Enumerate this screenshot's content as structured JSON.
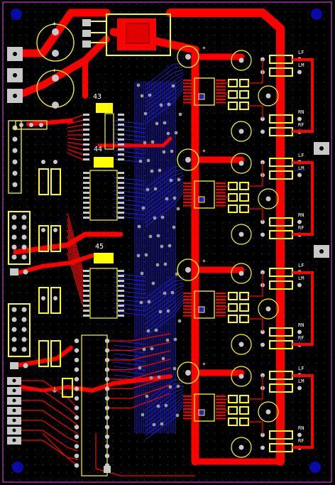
{
  "colors": {
    "background": "#000000",
    "top_copper": "#ff0000",
    "bottom_copper": "#1f1fd6",
    "silkscreen": "#ffff00",
    "pad": "#c8c8c8",
    "via": "#9a9aa0",
    "outline": "#c040c0",
    "mount_hole": "#0a0aa8",
    "label_text": "#ffffff"
  },
  "components": {
    "u43_label": "43",
    "u44_label": "44",
    "u45_label": "45"
  },
  "channel_labels": [
    {
      "top": "LF",
      "mid": "LM",
      "bot1": "RN",
      "bot2": "RF"
    },
    {
      "top": "LF",
      "mid": "LM",
      "bot1": "RN",
      "bot2": "RF"
    },
    {
      "top": "LF",
      "mid": "LM",
      "bot1": "RN",
      "bot2": "RF"
    },
    {
      "top": "LF",
      "mid": "LM",
      "bot1": "RN",
      "bot2": "RF"
    }
  ],
  "marks": {
    "plus": "+",
    "ground_symbol": "⏚"
  }
}
